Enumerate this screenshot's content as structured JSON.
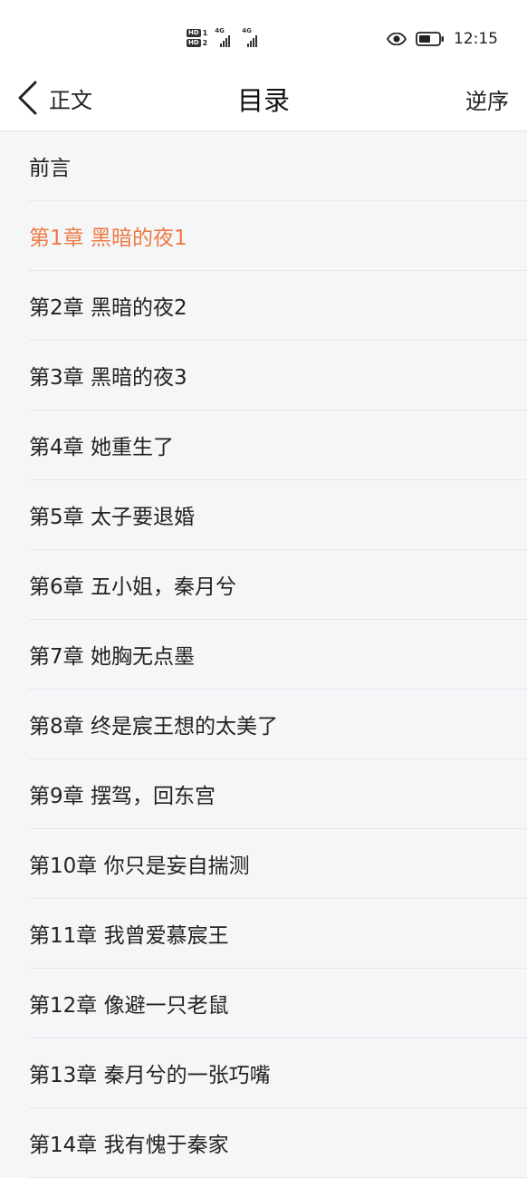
{
  "status_bar": {
    "time": "12:15",
    "hd1": "HD",
    "hd1_slot": "1",
    "hd2": "HD",
    "hd2_slot": "2",
    "net1": "4G",
    "net2": "4G"
  },
  "header": {
    "back_label": "正文",
    "title": "目录",
    "reverse_label": "逆序"
  },
  "toc": {
    "items": [
      {
        "label": "前言"
      },
      {
        "label": "第1章 黑暗的夜1"
      },
      {
        "label": "第2章 黑暗的夜2"
      },
      {
        "label": "第3章 黑暗的夜3"
      },
      {
        "label": "第4章 她重生了"
      },
      {
        "label": "第5章 太子要退婚"
      },
      {
        "label": "第6章 五小姐，秦月兮"
      },
      {
        "label": "第7章 她胸无点墨"
      },
      {
        "label": "第8章 终是宸王想的太美了"
      },
      {
        "label": "第9章 摆驾，回东宫"
      },
      {
        "label": "第10章 你只是妄自揣测"
      },
      {
        "label": "第11章 我曾爱慕宸王"
      },
      {
        "label": "第12章 像避一只老鼠"
      },
      {
        "label": "第13章 秦月兮的一张巧嘴"
      },
      {
        "label": "第14章 我有愧于秦家"
      }
    ],
    "active_index": 1
  },
  "colors": {
    "active": "#ee7a45",
    "text": "#222222",
    "background": "#f5f6f8"
  }
}
